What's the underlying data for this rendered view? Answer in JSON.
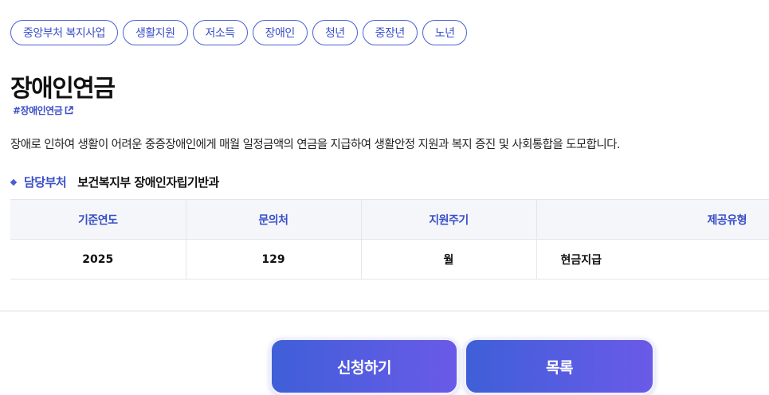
{
  "tags": [
    "중앙부처 복지사업",
    "생활지원",
    "저소득",
    "장애인",
    "청년",
    "중장년",
    "노년"
  ],
  "page_title": "장애인연금",
  "hashtag": "#장애인연금",
  "description": "장애로 인하여 생활이 어려운 중증장애인에게 매월 일정금액의 연금을 지급하여 생활안정 지원과 복지 증진 및 사회통합을 도모합니다.",
  "department": {
    "label": "담당부처",
    "value": "보건복지부 장애인자립기반과"
  },
  "table": {
    "headers": [
      "기준연도",
      "문의처",
      "지원주기",
      "제공유형"
    ],
    "row": [
      "2025",
      "129",
      "월",
      "현금지급"
    ]
  },
  "buttons": {
    "apply": "신청하기",
    "list": "목록"
  },
  "colors": {
    "accent": "#3a4fc8",
    "button_gradient_start": "#3f5fd8",
    "button_gradient_end": "#6a5ae8"
  },
  "icons": {
    "hashtag_link": "external-link-icon"
  }
}
